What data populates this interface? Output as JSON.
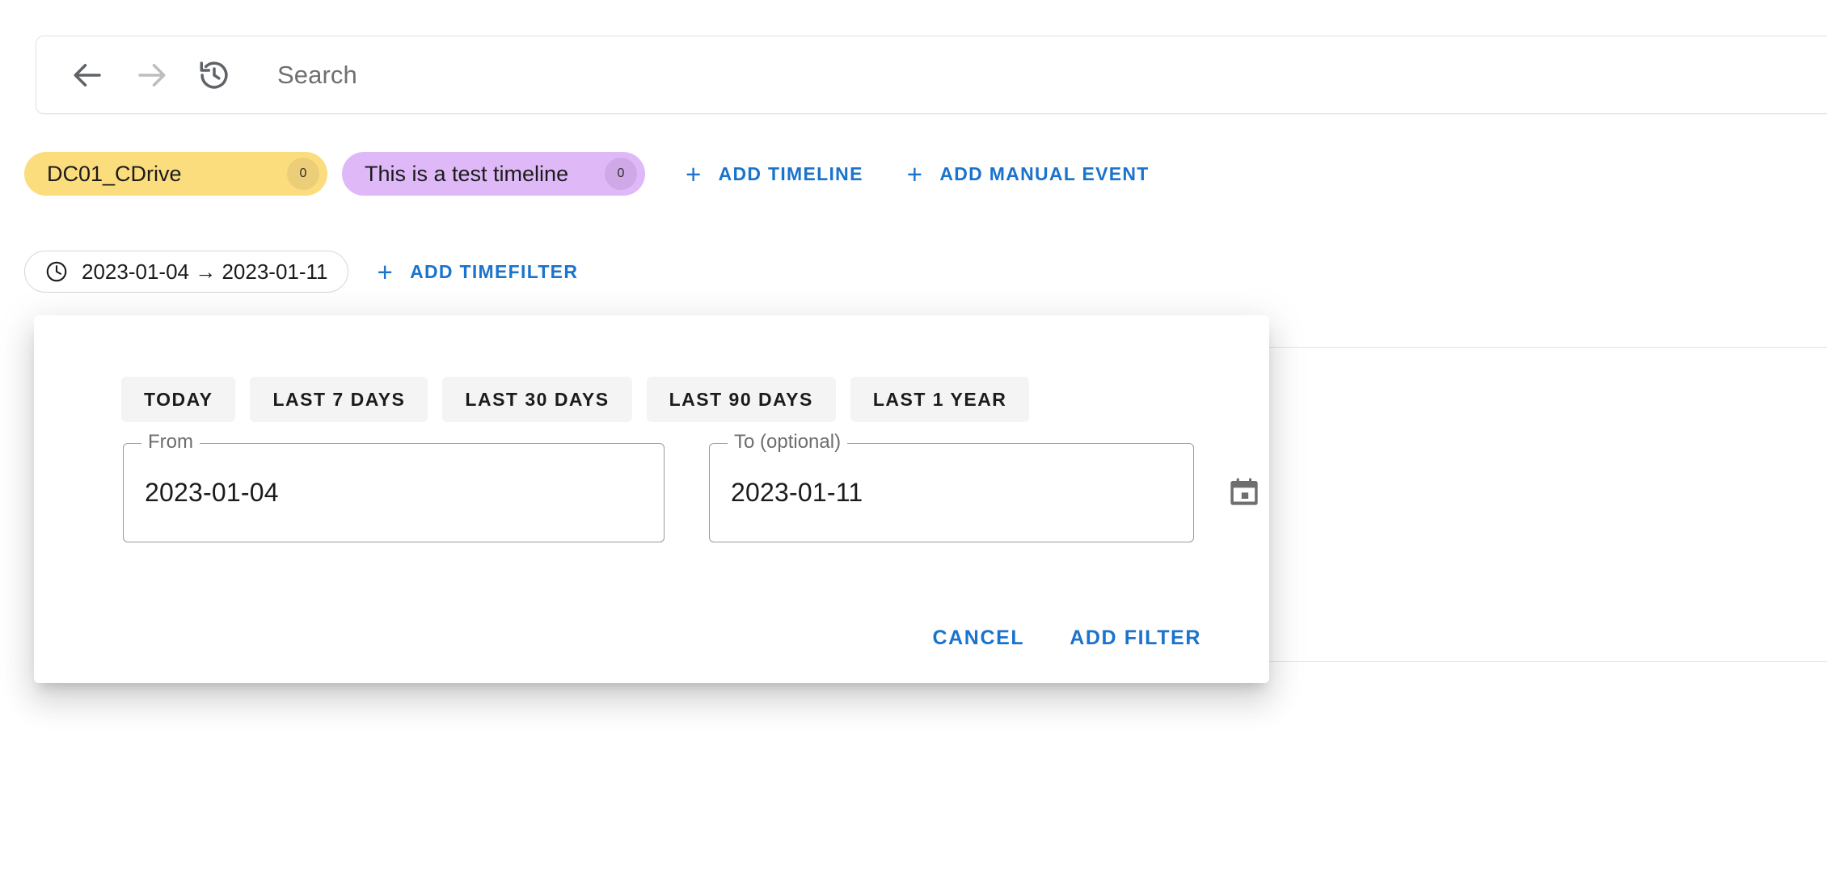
{
  "search": {
    "placeholder": "Search",
    "back_icon": "arrow-back-icon",
    "forward_icon": "arrow-forward-icon",
    "history_icon": "history-icon"
  },
  "chips": [
    {
      "label": "DC01_CDrive",
      "count": "0",
      "color": "#fbdd7e",
      "badge_color": "#ecce79"
    },
    {
      "label": "This is a test timeline",
      "count": "0",
      "color": "#dfb8f8",
      "badge_color": "#cfa8e8"
    }
  ],
  "toolbar": {
    "add_timeline": "ADD TIMELINE",
    "add_manual_event": "ADD MANUAL EVENT",
    "plus": "+"
  },
  "timefilter": {
    "chip_label": "2023-01-04 → 2023-01-11",
    "add_label": "ADD TIMEFILTER"
  },
  "dialog": {
    "presets": [
      "TODAY",
      "LAST 7 DAYS",
      "LAST 30 DAYS",
      "LAST 90 DAYS",
      "LAST 1 YEAR"
    ],
    "from": {
      "label": "From",
      "value": "2023-01-04"
    },
    "to": {
      "label": "To (optional)",
      "value": "2023-01-11"
    },
    "calendar_icon": "calendar-icon",
    "cancel": "CANCEL",
    "add_filter": "ADD FILTER"
  },
  "colors": {
    "accent": "#1a73cc",
    "text": "#1b1b1b",
    "muted": "#6f6f6f"
  }
}
